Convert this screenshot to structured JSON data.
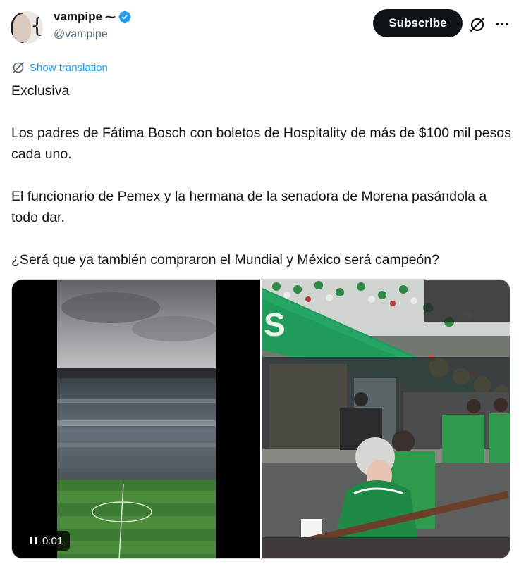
{
  "author": {
    "display_name": "vampipe",
    "name_suffix": "⁓",
    "handle": "@vampipe",
    "verified_color": "#1d9bf0"
  },
  "actions": {
    "subscribe_label": "Subscribe",
    "grok_icon": "grok-slash-circle-icon",
    "more_icon": "more-dots-icon"
  },
  "translation": {
    "label": "Show translation",
    "icon": "translate-icon"
  },
  "tweet": {
    "paragraphs": [
      "Exclusiva",
      "Los padres de Fátima Bosch con boletos de Hospitality de más de $100 mil pesos cada uno.",
      "El funcionario de Pemex y la hermana de la senadora de Morena pasándola a todo dar.",
      "¿Será que ya también compraron el Mundial y México será campeón?"
    ]
  },
  "media": {
    "video": {
      "elapsed": "0:01",
      "playback_icon": "pause-icon"
    },
    "photo": {
      "subject": "stadium-hospitality-box-photo"
    }
  },
  "colors": {
    "accent": "#1d9bf0",
    "text": "#0f1419",
    "secondary_text": "#536471"
  }
}
